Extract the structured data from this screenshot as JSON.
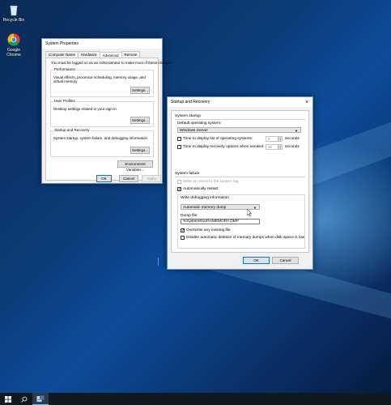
{
  "desktop": {
    "icons": [
      {
        "label": "Recycle Bin"
      },
      {
        "label": "Google Chrome"
      }
    ]
  },
  "system_properties": {
    "title": "System Properties",
    "tabs": [
      "Computer Name",
      "Hardware",
      "Advanced",
      "Remote"
    ],
    "active_tab": "Advanced",
    "admin_note": "You must be logged on as an Administrator to make most of these changes.",
    "performance": {
      "title": "Performance",
      "desc": "Visual effects, processor scheduling, memory usage, and virtual memory",
      "button": "Settings..."
    },
    "user_profiles": {
      "title": "User Profiles",
      "desc": "Desktop settings related to your sign-in",
      "button": "Settings..."
    },
    "startup_recovery": {
      "title": "Startup and Recovery",
      "desc": "System startup, system failure, and debugging information",
      "button": "Settings..."
    },
    "env_button": "Environment Variables...",
    "ok": "OK",
    "cancel": "Cancel",
    "apply": "Apply"
  },
  "startup_dialog": {
    "title": "Startup and Recovery",
    "close": "×",
    "system_startup": "System startup",
    "default_os_label": "Default operating system:",
    "default_os_value": "Windows Server",
    "time_list_label": "Time to display list of operating systems:",
    "time_list_value": "0",
    "time_recovery_label": "Time to display recovery options when needed:",
    "time_recovery_value": "30",
    "seconds": "seconds",
    "system_failure": "System failure",
    "write_event": "Write an event to the system log",
    "auto_restart": "Automatically restart",
    "write_debug": "Write debugging information",
    "dump_type": "Automatic memory dump",
    "dump_file_label": "Dump file:",
    "dump_file_value": "%SystemRoot%\\MEMORY.DMP",
    "overwrite": "Overwrite any existing file",
    "disable_auto_delete": "Disable automatic deletion of memory dumps when disk space is low",
    "ok": "OK",
    "cancel": "Cancel"
  },
  "taskbar": {
    "start_icon": "windows-logo-icon",
    "search_icon": "search-icon",
    "server_manager_icon": "server-manager-icon"
  },
  "colors": {
    "accent": "#0078d7",
    "desktop": "#0c3d7c",
    "taskbar": "#101820"
  }
}
